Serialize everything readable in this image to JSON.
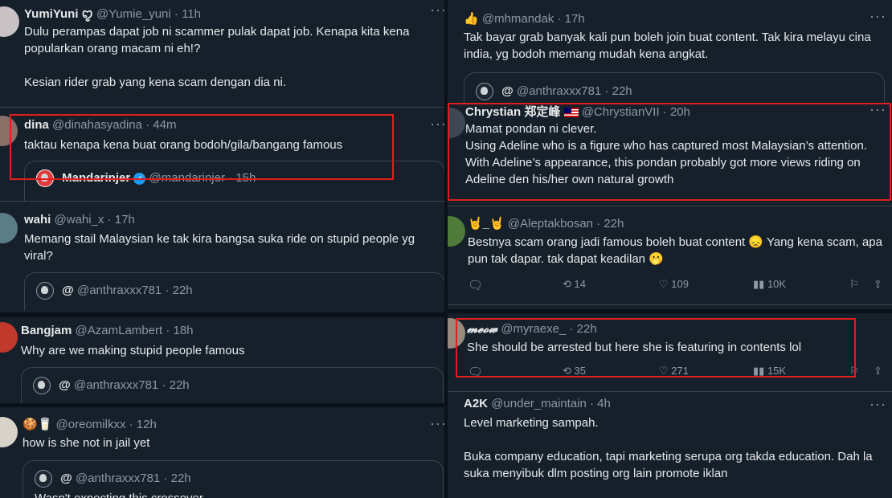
{
  "left": {
    "t1": {
      "name": "YumiYuni ꨄ︎",
      "handle": "@Yumie_yuni",
      "time": "11h",
      "body": "Dulu perampas dapat job ni scammer pulak dapat job. Kenapa kita kena popularkan orang macam ni eh!?\n\nKesian rider grab yang kena scam dengan dia ni."
    },
    "t2": {
      "name": "dina",
      "handle": "@dinahasyadina",
      "time": "44m",
      "body": "taktau kenapa kena buat orang bodoh/gila/bangang famous",
      "quote_name": "Mandarinjer",
      "quote_handle": "@mandarinjer",
      "quote_time": "15h"
    },
    "t3": {
      "name": "wahi",
      "handle": "@wahi_x",
      "time": "17h",
      "body": "Memang stail Malaysian ke tak kira bangsa suka ride on stupid people yg viral?",
      "quote_name": "@",
      "quote_handle": "@anthraxxx781",
      "quote_time": "22h"
    },
    "t4": {
      "name": "Bangjam",
      "handle": "@AzamLambert",
      "time": "18h",
      "body": "Why are we making stupid people famous",
      "quote_name": "@",
      "quote_handle": "@anthraxxx781",
      "quote_time": "22h"
    },
    "t5": {
      "name": "🍪🥛",
      "handle": "@oreomilkxx",
      "time": "12h",
      "body": "how is she not in jail yet",
      "quote_name": "@",
      "quote_handle": "@anthraxxx781",
      "quote_time": "22h",
      "quote_text": "Wasn't expecting this crossover"
    }
  },
  "right": {
    "r1": {
      "name": "👍",
      "handle": "@mhmandak",
      "time": "17h",
      "body": "Tak bayar grab banyak kali pun boleh join buat content. Tak kira melayu cina india, yg bodoh memang mudah kena angkat.",
      "quote_name": "@",
      "quote_handle": "@anthraxxx781",
      "quote_time": "22h"
    },
    "r2": {
      "name": "Chrystian 郑定峰",
      "handle": "@ChrystianVII",
      "time": "20h",
      "body": "Mamat pondan ni clever.\nUsing Adeline who is a figure who has captured most Malaysian’s attention. With Adeline’s appearance, this pondan probably got more views riding on Adeline den his/her own natural growth"
    },
    "r3": {
      "name": "🤘_🤘",
      "handle": "@Aleptakbosan",
      "time": "22h",
      "body": "Bestnya scam orang jadi famous boleh buat content 😞 Yang kena scam, apa pun tak dapar. tak dapat keadilan 🫢",
      "replies": "",
      "reposts": "14",
      "likes": "109",
      "views": "10K"
    },
    "r4": {
      "name": "𝓶𝓮𝓸𝔀",
      "handle": "@myraexe_",
      "time": "22h",
      "body": "She should be arrested but here she is featuring in contents lol",
      "replies": "",
      "reposts": "35",
      "likes": "271",
      "views": "15K"
    },
    "r5": {
      "name": "A2K",
      "handle": "@under_maintain",
      "time": "4h",
      "body": "Level marketing sampah.\n\nBuka company education, tapi marketing serupa org takda education. Dah la suka menyibuk dlm posting org lain promote iklan"
    }
  },
  "icons": {
    "more": "more-icon",
    "reply": "reply-icon",
    "repost": "repost-icon",
    "like": "like-icon",
    "views": "views-icon",
    "bookmark": "bookmark-icon",
    "share": "share-icon"
  },
  "colors": {
    "highlight": "#e01e1e",
    "background": "#15202b",
    "verified": "#1d9bf0"
  }
}
